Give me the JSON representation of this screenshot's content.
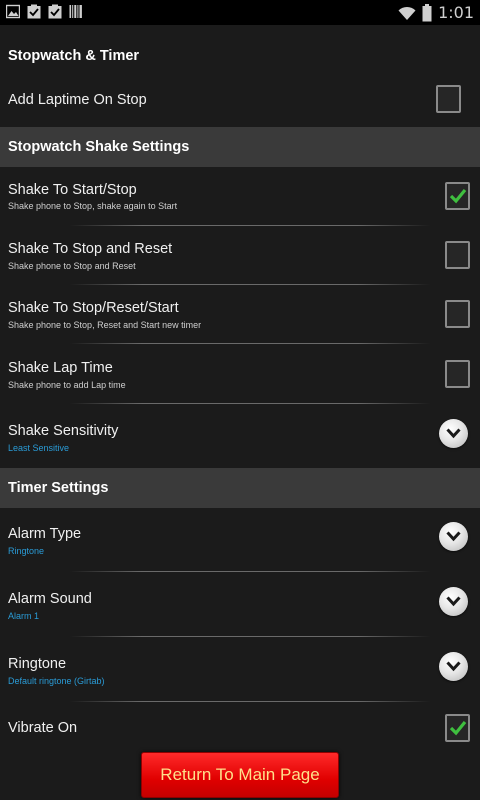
{
  "status_bar": {
    "time": "1:01",
    "icons": [
      "gallery-icon",
      "clipboard-check-icon",
      "clipboard-check-icon",
      "barcode-icon",
      "wifi-icon",
      "battery-icon"
    ]
  },
  "stopwatch_timer": {
    "title": "Stopwatch & Timer",
    "add_laptime": {
      "label": "Add Laptime On Stop",
      "checked": false
    }
  },
  "shake_settings": {
    "title": "Stopwatch Shake Settings",
    "items": [
      {
        "label": "Shake To Start/Stop",
        "summary": "Shake phone to Stop, shake again to Start",
        "checked": true
      },
      {
        "label": "Shake To Stop and Reset",
        "summary": "Shake phone to Stop and Reset",
        "checked": false
      },
      {
        "label": "Shake To Stop/Reset/Start",
        "summary": "Shake phone to Stop, Reset and Start new timer",
        "checked": false
      },
      {
        "label": "Shake Lap Time",
        "summary": "Shake phone to add Lap time",
        "checked": false
      }
    ],
    "sensitivity": {
      "label": "Shake Sensitivity",
      "value": "Least Sensitive"
    }
  },
  "timer_settings": {
    "title": "Timer Settings",
    "alarm_type": {
      "label": "Alarm Type",
      "value": "Ringtone"
    },
    "alarm_sound": {
      "label": "Alarm Sound",
      "value": "Alarm 1"
    },
    "ringtone": {
      "label": "Ringtone",
      "value": "Default ringtone (Girtab)"
    },
    "vibrate": {
      "label": "Vibrate On",
      "checked": true
    }
  },
  "return_button": {
    "label": "Return To Main Page"
  },
  "colors": {
    "accent_blue": "#2a9bd6",
    "check_green": "#3fbf3f",
    "button_red": "#e00000",
    "button_text": "#ffe08a"
  }
}
